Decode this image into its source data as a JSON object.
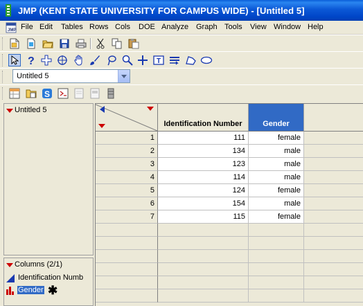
{
  "window": {
    "title": "JMP (KENT STATE UNIVERSITY FOR CAMPUS WIDE)  - [Untitled 5]"
  },
  "menu": [
    "File",
    "Edit",
    "Tables",
    "Rows",
    "Cols",
    "DOE",
    "Analyze",
    "Graph",
    "Tools",
    "View",
    "Window",
    "Help"
  ],
  "toolbar": {
    "table_select_value": "Untitled 5",
    "icons_row1": [
      "new-icon",
      "open-icon",
      "open-folder-icon",
      "save-icon",
      "print-icon",
      "cut-icon",
      "copy-icon",
      "paste-icon"
    ],
    "icons_row2": [
      "arrow-cursor-icon",
      "help-cursor-icon",
      "crosshair-icon",
      "target-icon",
      "hand-icon",
      "brush-icon",
      "lasso-icon",
      "magnifier-icon",
      "plus-icon",
      "text-annotate-icon",
      "line-annotate-icon",
      "polygon-icon",
      "ellipse-icon"
    ],
    "icons_row3": [
      "new-table-icon",
      "open-data-icon",
      "script-icon",
      "journal-icon",
      "document-icon",
      "report-icon",
      "layout-icon"
    ]
  },
  "left_panel": {
    "table_name": "Untitled 5",
    "columns_header": "Columns (2/1)",
    "columns": [
      {
        "name": "Identification Numb",
        "type": "continuous",
        "selected": false
      },
      {
        "name": "Gender",
        "type": "nominal",
        "selected": true,
        "marker": "✱"
      }
    ]
  },
  "grid": {
    "columns": [
      "Identification Number",
      "Gender"
    ],
    "selected_column": "Gender",
    "rows": [
      {
        "n": "1",
        "id": "111",
        "gender": "female"
      },
      {
        "n": "2",
        "id": "134",
        "gender": "male"
      },
      {
        "n": "3",
        "id": "123",
        "gender": "male"
      },
      {
        "n": "4",
        "id": "114",
        "gender": "male"
      },
      {
        "n": "5",
        "id": "124",
        "gender": "female"
      },
      {
        "n": "6",
        "id": "154",
        "gender": "male"
      },
      {
        "n": "7",
        "id": "115",
        "gender": "female"
      }
    ],
    "empty_rows": 6
  },
  "colors": {
    "titlebar": "#0b58d6",
    "selection": "#316ac5",
    "hotspot_red": "#cc0000"
  }
}
